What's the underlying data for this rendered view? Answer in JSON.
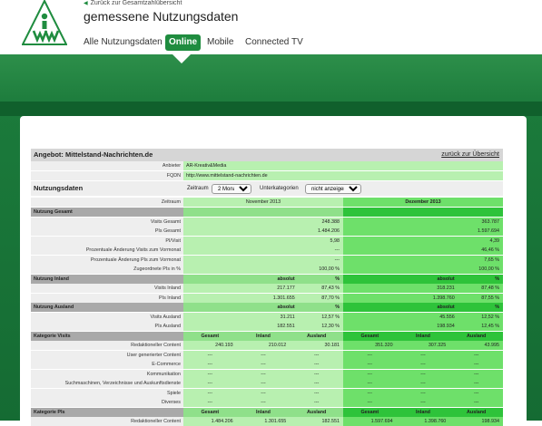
{
  "header": {
    "back_link": "Zurück zur Gesamtzahlübersicht",
    "title": "gemessene Nutzungsdaten",
    "logo_text": "IVW"
  },
  "nav": {
    "items": [
      {
        "label": "Alle Nutzungsdaten"
      },
      {
        "label": "Online"
      },
      {
        "label": "Mobile"
      },
      {
        "label": "Connected TV"
      }
    ]
  },
  "offer": {
    "title": "Angebot: Mittelstand-Nachrichten.de",
    "back_overview": "zurück zur Übersicht",
    "anbieter_label": "Anbieter",
    "anbieter_value": "AR-Kreativ&Media",
    "fqdn_label": "FQDN",
    "fqdn_value": "http://www.mittelstand-nachrichten.de"
  },
  "nutzungsdaten": {
    "label": "Nutzungsdaten",
    "zeitraum_label": "Zeitraum",
    "zeitraum_value": "2 Monate",
    "unterkategorien_label": "Unterkategorien",
    "unterkategorien_value": "nicht anzeigen"
  },
  "columns": {
    "zeitraum_label": "Zeitraum",
    "month1": "November 2013",
    "month2": "Dezember 2013"
  },
  "nutzung_gesamt": {
    "header": "Nutzung Gesamt",
    "rows": [
      {
        "label": "Visits Gesamt",
        "v1": "248.388",
        "p1": "",
        "v2": "363.787",
        "p2": ""
      },
      {
        "label": "PIs Gesamt",
        "v1": "1.484.206",
        "p1": "",
        "v2": "1.597.694",
        "p2": ""
      },
      {
        "label": "PI/Visit",
        "v1": "5,98",
        "p1": "",
        "v2": "4,39",
        "p2": ""
      },
      {
        "label": "Prozentuale Änderung Visits zum Vormonat",
        "v1": "---",
        "p1": "",
        "v2": "46,46 %",
        "p2": ""
      },
      {
        "label": "Prozentuale Änderung PIs zum Vormonat",
        "v1": "---",
        "p1": "",
        "v2": "7,65 %",
        "p2": ""
      },
      {
        "label": "Zugeordnete PIs in %",
        "v1": "100,00 %",
        "p1": "",
        "v2": "100,00 %",
        "p2": ""
      }
    ]
  },
  "nutzung_inland": {
    "header": "Nutzung Inland",
    "col_abs": "absolut",
    "col_pct": "%",
    "rows": [
      {
        "label": "Visits Inland",
        "v1": "217.177",
        "p1": "87,43 %",
        "v2": "318.231",
        "p2": "87,48 %"
      },
      {
        "label": "PIs Inland",
        "v1": "1.301.655",
        "p1": "87,70 %",
        "v2": "1.398.760",
        "p2": "87,55 %"
      }
    ]
  },
  "nutzung_ausland": {
    "header": "Nutzung Ausland",
    "col_abs": "absolut",
    "col_pct": "%",
    "rows": [
      {
        "label": "Visits Ausland",
        "v1": "31.211",
        "p1": "12,57 %",
        "v2": "45.556",
        "p2": "12,52 %"
      },
      {
        "label": "PIs Ausland",
        "v1": "182.551",
        "p1": "12,30 %",
        "v2": "198.934",
        "p2": "12,45 %"
      }
    ]
  },
  "kategorie_visits": {
    "header": "Kategorie Visits",
    "cols": [
      "Gesamt",
      "Inland",
      "Ausland",
      "Gesamt",
      "Inland",
      "Ausland"
    ],
    "rows": [
      {
        "label": "Redaktioneller Content",
        "vals": [
          "240.193",
          "210.012",
          "30.181",
          "351.320",
          "307.325",
          "43.995"
        ]
      },
      {
        "label": "User generierter Content",
        "vals": [
          "---",
          "---",
          "---",
          "---",
          "---",
          "---"
        ]
      },
      {
        "label": "E-Commerce",
        "vals": [
          "---",
          "---",
          "---",
          "---",
          "---",
          "---"
        ]
      },
      {
        "label": "Kommunikation",
        "vals": [
          "---",
          "---",
          "---",
          "---",
          "---",
          "---"
        ]
      },
      {
        "label": "Suchmaschinen, Verzeichnisse und Auskunftsdienste",
        "vals": [
          "---",
          "---",
          "---",
          "---",
          "---",
          "---"
        ]
      },
      {
        "label": "Spiele",
        "vals": [
          "---",
          "---",
          "---",
          "---",
          "---",
          "---"
        ]
      },
      {
        "label": "Diverses",
        "vals": [
          "---",
          "---",
          "---",
          "---",
          "---",
          "---"
        ]
      }
    ]
  },
  "kategorie_pis": {
    "header": "Kategorie PIs",
    "cols": [
      "Gesamt",
      "Inland",
      "Ausland",
      "Gesamt",
      "Inland",
      "Ausland"
    ],
    "rows": [
      {
        "label": "Redaktioneller Content",
        "vals": [
          "1.484.206",
          "1.301.655",
          "182.551",
          "1.597.694",
          "1.398.760",
          "198.934"
        ]
      }
    ]
  },
  "colors": {
    "brand_green": "#1f8c3f",
    "light_green": "#b8f0b0",
    "bright_green": "#6ee06a"
  }
}
